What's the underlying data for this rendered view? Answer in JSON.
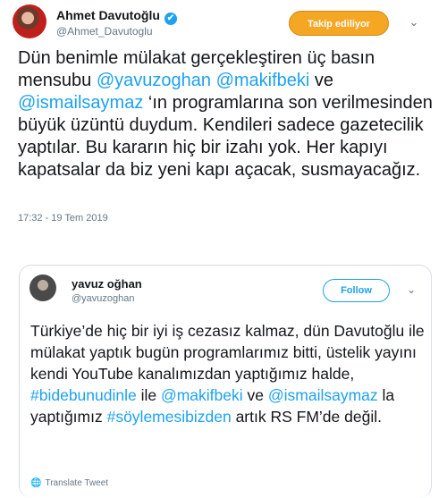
{
  "tweet": {
    "author_name": "Ahmet Davutoğlu",
    "verified_glyph": "✔",
    "handle": "@Ahmet_Davutoglu",
    "follow_button": "Takip ediliyor",
    "chevron": "⌄",
    "text_parts": [
      "Dün benimle mülakat gerçekleştiren üç basın mensubu ",
      "@yavuzoghan",
      " ",
      "@makifbeki",
      " ve ",
      "@ismailsaymaz",
      " ‘ın programlarına son verilmesinden büyük üzüntü duydum. Kendileri sadece gazetecilik yaptılar. Bu kararın hiç bir izahı yok. Her kapıyı kapatsalar da biz yeni kapı açacak, susmayacağız."
    ],
    "timestamp": "17:32 - 19 Tem 2019"
  },
  "quoted": {
    "author_name": "yavuz oğhan",
    "handle": "@yavuzoghan",
    "follow_button": "Follow",
    "chevron": "⌄",
    "text_parts": [
      "Türkiye’de hiç bir iyi iş cezasız kalmaz, dün Davutoğlu ile mülakat yaptık bugün programlarımız bitti, üstelik yayını kendi YouTube kanalımızdan yaptığımız halde, ",
      "#bidebunudinle",
      " ile ",
      "@makifbeki",
      " ve ",
      "@ismailsaymaz",
      " la yaptığımız ",
      "#söylemesibizden",
      " artık RS FM’de değil."
    ],
    "translate_icon": "🌐",
    "translate_label": "Translate Tweet"
  },
  "colors": {
    "link": "#1da1f2",
    "follow_orange": "#f5a623",
    "muted": "#657786"
  }
}
